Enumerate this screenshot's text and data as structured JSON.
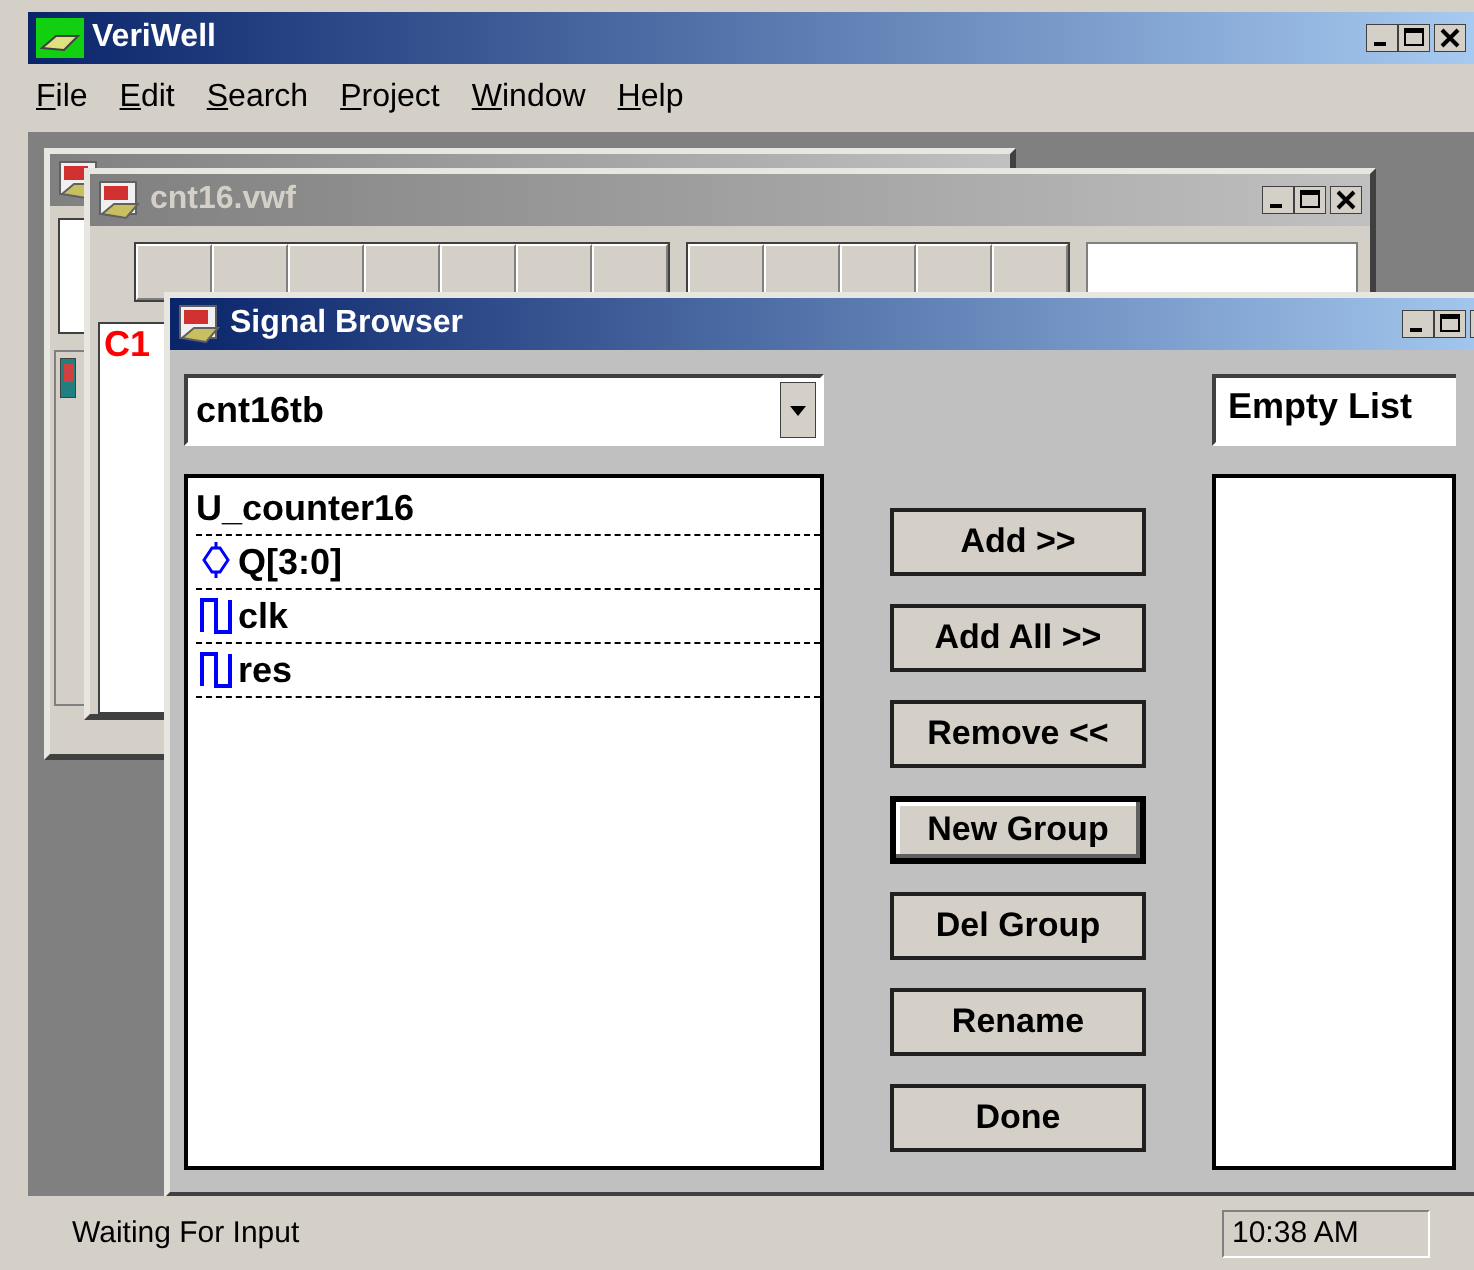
{
  "app": {
    "title": "VeriWell",
    "menu": [
      {
        "label": "File"
      },
      {
        "label": "Edit"
      },
      {
        "label": "Search"
      },
      {
        "label": "Project"
      },
      {
        "label": "Window"
      },
      {
        "label": "Help"
      }
    ]
  },
  "waveform_window": {
    "title": "cnt16.vwf",
    "marker": "C1"
  },
  "signal_browser": {
    "title": "Signal Browser",
    "module": "cnt16tb",
    "group": "Empty List",
    "tree": {
      "label": "U_counter16",
      "children": [
        {
          "label": "Q[3:0]",
          "kind": "bus"
        },
        {
          "label": "clk",
          "kind": "wire"
        },
        {
          "label": "res",
          "kind": "wire"
        }
      ]
    },
    "buttons": [
      {
        "label": "Add >>",
        "focused": false
      },
      {
        "label": "Add All >>",
        "focused": false
      },
      {
        "label": "Remove <<",
        "focused": false
      },
      {
        "label": "New Group",
        "focused": true
      },
      {
        "label": "Del Group",
        "focused": false
      },
      {
        "label": "Rename",
        "focused": false
      },
      {
        "label": "Done",
        "focused": false
      }
    ]
  },
  "status_bar": {
    "message": "Waiting For Input",
    "clock": "10:38 AM"
  }
}
